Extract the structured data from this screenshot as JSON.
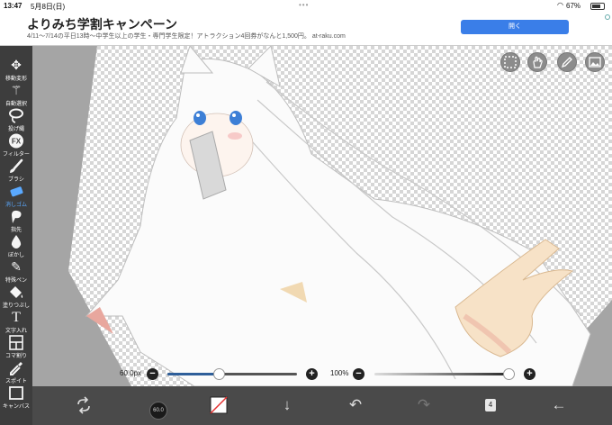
{
  "status_bar": {
    "time": "13:47",
    "date": "5月8日(日)",
    "battery_percent": "67%"
  },
  "ad": {
    "title": "よりみち学割キャンペーン",
    "subtitle": "4/11〜7/14の平日13時〜中学生以上の学生・専門学生限定！アトラクション4回券がなんと1,500円。 at-raku.com",
    "button_label": "開く"
  },
  "tools": [
    {
      "icon": "move-icon",
      "label": "移動変形"
    },
    {
      "icon": "magic-wand-icon",
      "label": "自動選択"
    },
    {
      "icon": "lasso-icon",
      "label": "投げ縄"
    },
    {
      "icon": "fx-icon",
      "label": "フィルター"
    },
    {
      "icon": "brush-icon",
      "label": "ブラシ"
    },
    {
      "icon": "eraser-icon",
      "label": "消しゴム",
      "active": true
    },
    {
      "icon": "finger-icon",
      "label": "指先"
    },
    {
      "icon": "blur-icon",
      "label": "ぼかし"
    },
    {
      "icon": "special-pen-icon",
      "label": "特殊ペン"
    },
    {
      "icon": "fill-icon",
      "label": "塗りつぶし"
    },
    {
      "icon": "text-icon",
      "label": "文字入れ"
    },
    {
      "icon": "frame-divider-icon",
      "label": "コマ割り"
    },
    {
      "icon": "eyedropper-icon",
      "label": "スポイト"
    },
    {
      "icon": "canvas-icon",
      "label": "キャンバス"
    }
  ],
  "canvas_buttons": [
    "selection-icon",
    "hand-icon",
    "pen-icon",
    "image-icon"
  ],
  "brush_slider": {
    "label": "60.0px",
    "value": 0.4
  },
  "opacity_slider": {
    "label": "100%",
    "value": 1.0
  },
  "bottom_bar": {
    "brush_size_text": "60.0",
    "layer_count": "4"
  },
  "colors": {
    "accent": "#5aa9ff",
    "toolbar_bg": "#3d3d3d",
    "bottom_bar_bg": "#4a4a4a",
    "brush_slider_fill": "#2f5f9a"
  }
}
